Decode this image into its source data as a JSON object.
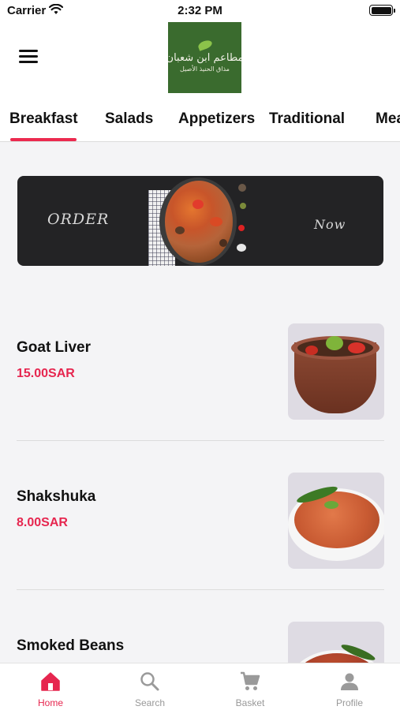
{
  "status_bar": {
    "carrier": "Carrier",
    "time": "2:32 PM"
  },
  "header": {
    "menu_icon": "hamburger-menu-icon"
  },
  "tabs": [
    {
      "label": "Breakfast",
      "active": true
    },
    {
      "label": "Salads"
    },
    {
      "label": "Appetizers"
    },
    {
      "label": "Traditional"
    },
    {
      "label": "Mea"
    }
  ],
  "banner": {
    "left_text": "ORDER",
    "right_text": "Now"
  },
  "dishes": [
    {
      "name": "Goat Liver",
      "price": "15.00SAR"
    },
    {
      "name": "Shakshuka",
      "price": "8.00SAR"
    },
    {
      "name": "Smoked Beans",
      "price": ""
    }
  ],
  "bottom_nav": [
    {
      "label": "Home",
      "icon": "home-icon",
      "active": true
    },
    {
      "label": "Search",
      "icon": "search-icon"
    },
    {
      "label": "Basket",
      "icon": "cart-icon"
    },
    {
      "label": "Profile",
      "icon": "person-icon"
    }
  ],
  "colors": {
    "accent": "#e6264f",
    "logo_green": "#3a6b2e",
    "banner_bg": "#232325"
  }
}
